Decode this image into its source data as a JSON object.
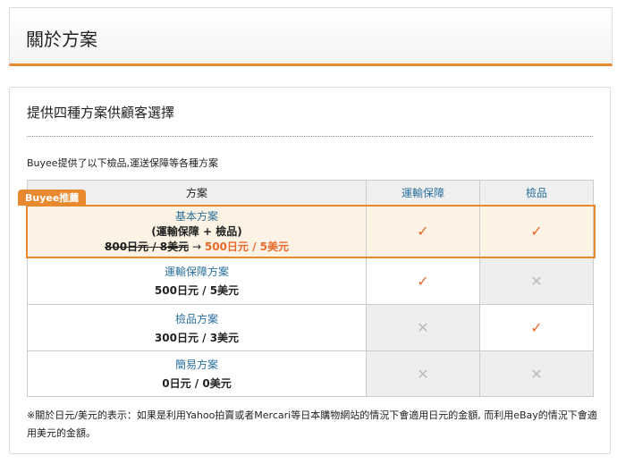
{
  "header": {
    "title": "關於方案"
  },
  "panel": {
    "subtitle": "提供四種方案供顧客選擇",
    "intro": "Buyee提供了以下檢品,運送保障等各種方案"
  },
  "table": {
    "headers": [
      "方案",
      "運輸保障",
      "檢品"
    ],
    "badge": "Buyee推薦",
    "rows": [
      {
        "name": "基本方案",
        "detail": "(運輸保障 + 檢品)",
        "old_price": "800日元 / 8美元",
        "arrow": "→",
        "price": "500日元 / 5美元",
        "shipping": true,
        "inspection": true,
        "recommended": true
      },
      {
        "name": "運輸保障方案",
        "price": "500日元 / 5美元",
        "shipping": true,
        "inspection": false
      },
      {
        "name": "檢品方案",
        "price": "300日元 / 3美元",
        "shipping": false,
        "inspection": true
      },
      {
        "name": "簡易方案",
        "price": "0日元 / 0美元",
        "shipping": false,
        "inspection": false
      }
    ]
  },
  "note": "※關於日元/美元的表示：如果是利用Yahoo拍賣或者Mercari等日本購物網站的情況下會適用日元的金額,  而利用eBay的情況下會適用美元的金額。",
  "icons": {
    "check": "✓",
    "cross": "✕"
  },
  "colors": {
    "accent": "#e8892f",
    "link": "#2a6f9b"
  }
}
